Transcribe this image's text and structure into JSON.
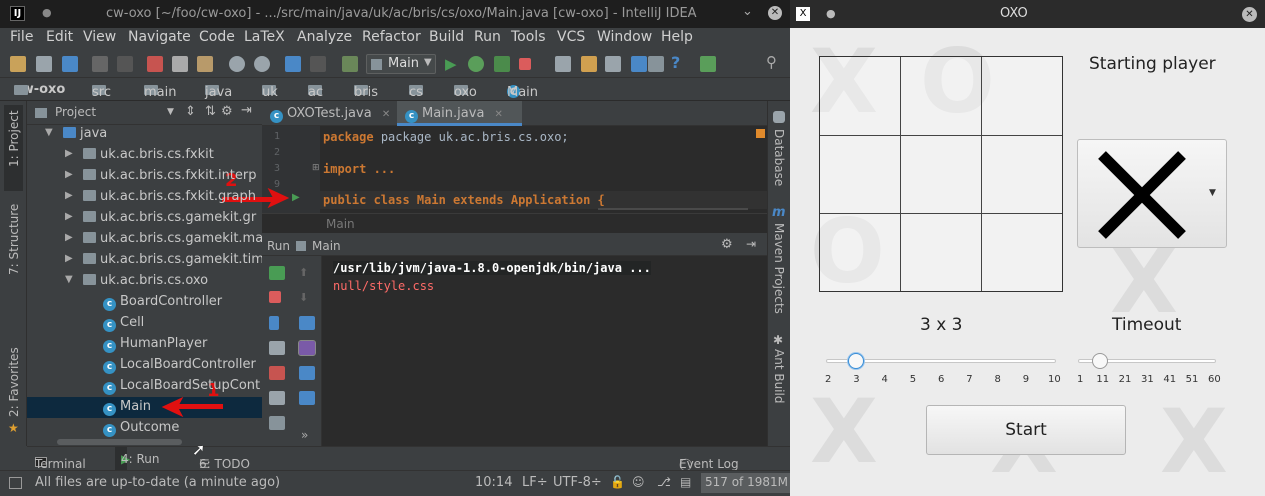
{
  "ide": {
    "title": "cw-oxo [~/foo/cw-oxo] - .../src/main/java/uk/ac/bris/cs/oxo/Main.java [cw-oxo] - IntelliJ IDEA",
    "menu": [
      "File",
      "Edit",
      "View",
      "Navigate",
      "Code",
      "LaTeX",
      "Analyze",
      "Refactor",
      "Build",
      "Run",
      "Tools",
      "VCS",
      "Window",
      "Help"
    ],
    "run_config": "Main",
    "breadcrumb": [
      "cw-oxo",
      "src",
      "main",
      "java",
      "uk",
      "ac",
      "bris",
      "cs",
      "oxo",
      "Main"
    ],
    "project_header": "Project",
    "tree": [
      {
        "label": "java",
        "kind": "folder",
        "expanded": true,
        "indent": 0
      },
      {
        "label": "uk.ac.bris.cs.fxkit",
        "kind": "package",
        "expanded": false,
        "indent": 1
      },
      {
        "label": "uk.ac.bris.cs.fxkit.interp",
        "kind": "package",
        "expanded": false,
        "indent": 1
      },
      {
        "label": "uk.ac.bris.cs.fxkit.graph",
        "kind": "package",
        "expanded": false,
        "indent": 1
      },
      {
        "label": "uk.ac.bris.cs.gamekit.gr",
        "kind": "package",
        "expanded": false,
        "indent": 1
      },
      {
        "label": "uk.ac.bris.cs.gamekit.ma",
        "kind": "package",
        "expanded": false,
        "indent": 1
      },
      {
        "label": "uk.ac.bris.cs.gamekit.tim",
        "kind": "package",
        "expanded": false,
        "indent": 1
      },
      {
        "label": "uk.ac.bris.cs.oxo",
        "kind": "package",
        "expanded": true,
        "indent": 1
      },
      {
        "label": "BoardController",
        "kind": "class",
        "indent": 2
      },
      {
        "label": "Cell",
        "kind": "class",
        "indent": 2
      },
      {
        "label": "HumanPlayer",
        "kind": "class",
        "indent": 2
      },
      {
        "label": "LocalBoardController",
        "kind": "class",
        "indent": 2
      },
      {
        "label": "LocalBoardSetupCont",
        "kind": "class",
        "indent": 2
      },
      {
        "label": "Main",
        "kind": "class",
        "indent": 2
      },
      {
        "label": "Outcome",
        "kind": "class",
        "indent": 2
      }
    ],
    "left_tools": [
      "1: Project",
      "7: Structure",
      "2: Favorites"
    ],
    "tabs": [
      "OXOTest.java",
      "Main.java"
    ],
    "code_lines": [
      {
        "n": "1",
        "text": "package uk.ac.bris.cs.oxo;"
      },
      {
        "n": "3",
        "text": "import ..."
      },
      {
        "n": "9",
        "text": ""
      },
      {
        "n": "",
        "text": "public class Main extends Application {"
      }
    ],
    "editor_footer": "Main",
    "run_title": "Run",
    "run_config_tab": "Main",
    "console": [
      "/usr/lib/jvm/java-1.8.0-openjdk/bin/java ...",
      "null/style.css"
    ],
    "right_tools": [
      "Database",
      "Maven Projects",
      "Ant Build"
    ],
    "bottom_tabs": [
      "Terminal",
      "4: Run",
      "6: TODO",
      "Event Log"
    ],
    "status": "All files are up-to-date (a minute ago)",
    "position": "10:14",
    "line_sep": "LF÷",
    "encoding": "UTF-8÷",
    "memory": "517 of 1981M",
    "annotation_1": "1",
    "annotation_2": "2"
  },
  "oxo": {
    "title": "OXO",
    "starting_player_label": "Starting player",
    "starting_player_value": "X",
    "size_label": "3 x 3",
    "size_ticks": [
      "2",
      "3",
      "4",
      "5",
      "6",
      "7",
      "8",
      "9",
      "10"
    ],
    "size_value": 3,
    "timeout_label": "Timeout",
    "timeout_ticks": [
      "1",
      "11",
      "21",
      "31",
      "41",
      "51",
      "60"
    ],
    "timeout_value": 11,
    "start_button": "Start"
  },
  "colors": {
    "accent_red": "#e01010",
    "keyword": "#cc7832",
    "console_red": "#ff6b68"
  }
}
